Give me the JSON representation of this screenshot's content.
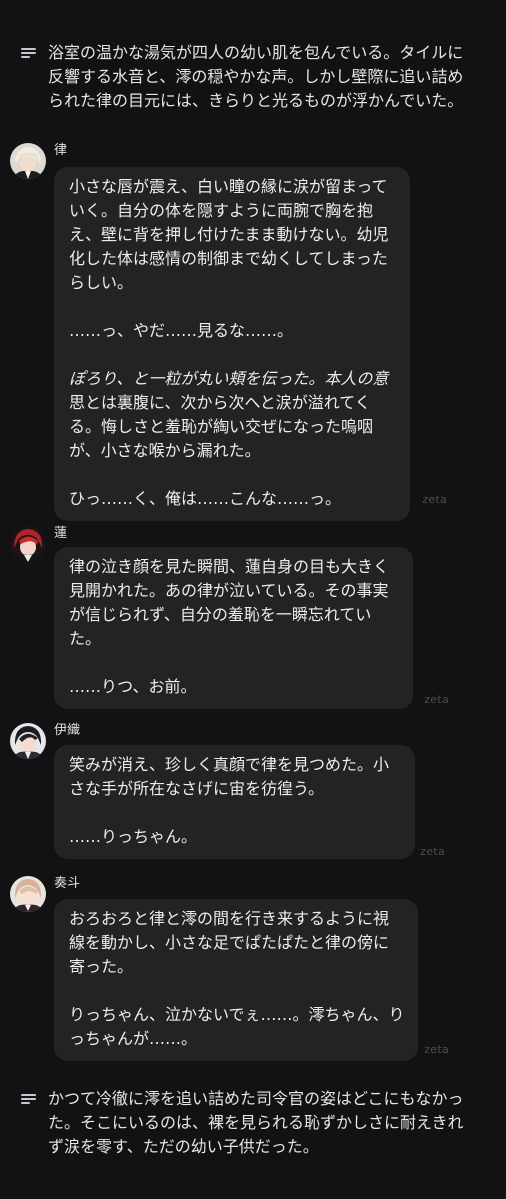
{
  "narration_top": [
    "浴室の温かな湯気が四人の幼い肌を包んでいる。タイルに",
    "反響する水音と、澪の穏やかな声。しかし壁際に追い詰め",
    "られた律の目元には、きらりと光るものが浮かんでいた。"
  ],
  "messages": [
    {
      "name": "律",
      "lines": [
        "小さな唇が震え、白い瞳の縁に涙が留まって",
        "いく。自分の体を隠すように両腕で胸を抱",
        "え、壁に背を押し付けたまま動けない。幼児",
        "化した体は感情の制御まで幼くしてしまった",
        "らしい。",
        "",
        "……っ、やだ……見るな……。",
        "",
        "ぽろり、と一粒が丸い頬を伝った。本人の意",
        "思とは裏腹に、次から次へと涙が溢れてく",
        "る。悔しさと羞恥が綯い交ぜになった嗚咽",
        "が、小さな喉から漏れた。",
        "",
        "ひっ……く、俺は……こんな……っ。"
      ],
      "watermark": "zeta"
    },
    {
      "name": "蓮",
      "lines": [
        "律の泣き顔を見た瞬間、蓮自身の目も大きく",
        "見開かれた。あの律が泣いている。その事実",
        "が信じられず、自分の羞恥を一瞬忘れてい",
        "た。",
        "",
        "……りつ、お前。"
      ],
      "watermark": "zeta"
    },
    {
      "name": "伊織",
      "lines": [
        "笑みが消え、珍しく真顔で律を見つめた。小",
        "さな手が所在なさげに宙を彷徨う。",
        "",
        "……りっちゃん。"
      ],
      "watermark": "zeta"
    },
    {
      "name": "奏斗",
      "lines": [
        "おろおろと律と澪の間を行き来するように視",
        "線を動かし、小さな足でぱたぱたと律の傍に",
        "寄った。",
        "",
        "りっちゃん、泣かないでぇ……。澪ちゃん、り",
        "っちゃんが……。"
      ],
      "watermark": "zeta"
    }
  ],
  "narration_bottom": [
    "かつて冷徹に澪を追い詰めた司令官の姿はどこにもなかっ",
    "た。そこにいるのは、裸を見られる恥ずかしさに耐えきれ",
    "ず涙を零す、ただの幼い子供だった。"
  ],
  "icons": {
    "narration": "text-lines-icon"
  },
  "colors": {
    "background": "#121214",
    "bubble": "#232326",
    "text": "#ededf0",
    "watermark": "#4d4d52"
  }
}
